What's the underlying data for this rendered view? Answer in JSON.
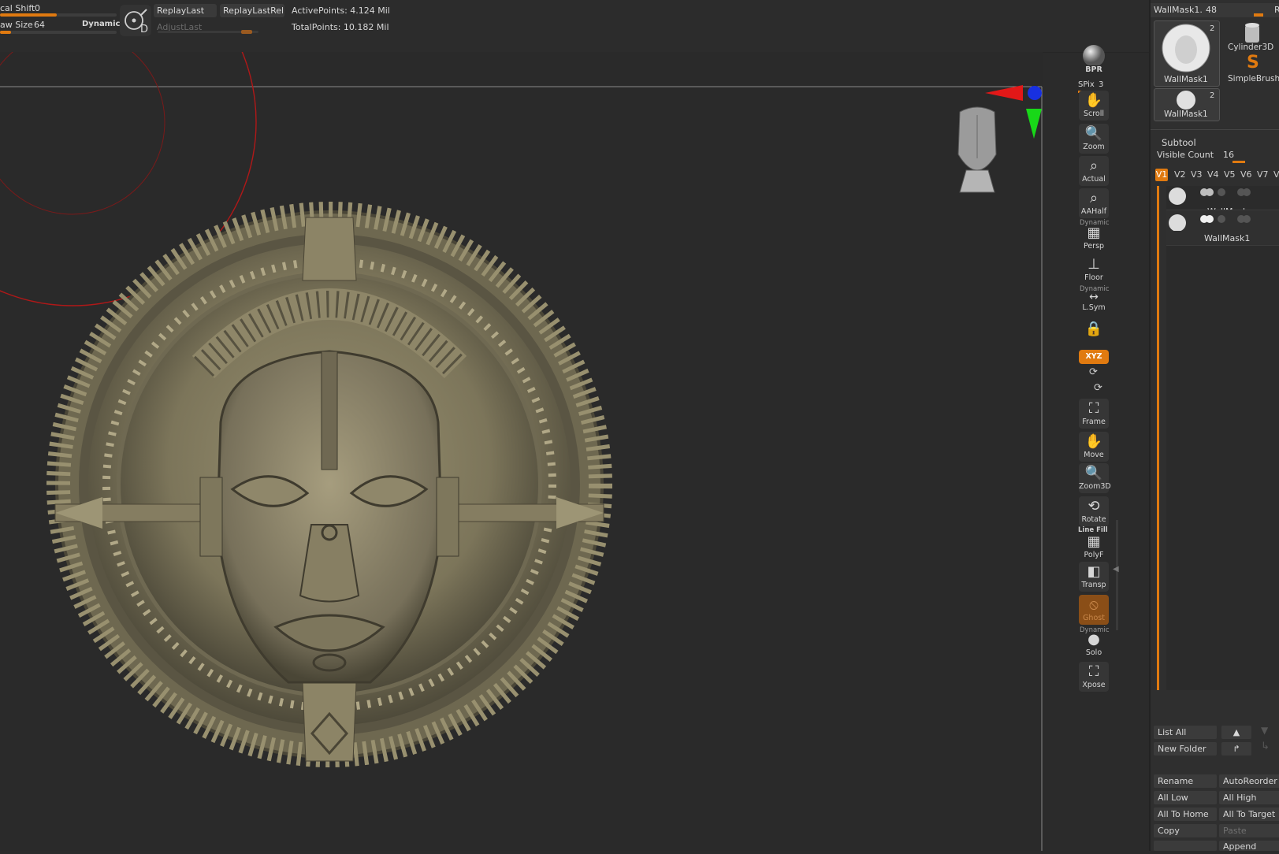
{
  "toolbar": {
    "focal_shift_label": "cal Shift",
    "focal_shift_value": "0",
    "focal_shift_level": 0.15,
    "draw_size_label": "aw Size",
    "draw_size_value": "64",
    "draw_size_level": 0.1,
    "dynamic_label": "Dynamic",
    "replay_last_label": "ReplayLast",
    "replay_last_rel_label": "ReplayLastRel",
    "adjust_last_label": "AdjustLast",
    "active_points": "ActivePoints: 4.124 Mil",
    "total_points": "TotalPoints: 10.182 Mil",
    "d_label": "D"
  },
  "shelf": {
    "bpr_label": "BPR",
    "spix_label": "SPix",
    "spix_value": "3",
    "buttons": [
      {
        "label": "Scroll",
        "icon": "hand-icon"
      },
      {
        "label": "Zoom",
        "icon": "zoom-icon"
      },
      {
        "label": "Actual",
        "icon": "actual-icon"
      },
      {
        "label": "AAHalf",
        "icon": "aahalf-icon"
      },
      {
        "label": "Persp",
        "icon": "persp-icon"
      },
      {
        "label": "Floor",
        "icon": "floor-icon"
      },
      {
        "label": "L.Sym",
        "icon": "lsym-icon"
      }
    ],
    "dynamic_top": "Dynamic",
    "dynamic_lsym": "Dynamic",
    "xyz_label": "XYZ",
    "frame_label": "Frame",
    "move_label": "Move",
    "zoom3d_label": "Zoom3D",
    "rotate_label": "Rotate",
    "line_fill_label": "Line Fill",
    "polyf_label": "PolyF",
    "transp_label": "Transp",
    "ghost_label": "Ghost",
    "dynamic_solo": "Dynamic",
    "solo_label": "Solo",
    "xpose_label": "Xpose"
  },
  "panel": {
    "tool_name": "WallMask1.",
    "tool_count": "48",
    "r_label": "R",
    "thumb1_label": "WallMask1",
    "thumb1_badge": "2",
    "cylinder_label": "Cylinder3D",
    "simplebrush_label": "SimpleBrush",
    "thumb2_label": "WallMask1",
    "thumb2_badge": "2",
    "subtool_title": "Subtool",
    "visible_count_label": "Visible Count",
    "visible_count_value": "16",
    "visible_count_level": 0.8,
    "vtabs": [
      "V1",
      "V2",
      "V3",
      "V4",
      "V5",
      "V6",
      "V7",
      "V"
    ],
    "subtools": [
      {
        "name": "WallMask"
      },
      {
        "name": "WallMask1"
      }
    ],
    "list_all": "List All",
    "new_folder": "New Folder",
    "rename": "Rename",
    "auto_reorder": "AutoReorder",
    "all_low": "All Low",
    "all_high": "All High",
    "all_to_home": "All To Home",
    "all_to_target": "All To Target",
    "copy": "Copy",
    "paste": "Paste",
    "append": "Append"
  },
  "colors": {
    "accent": "#e07a10",
    "background": "#2a2a2a",
    "brush_ring": "#b01818",
    "gizmo_red": "#e21818",
    "gizmo_green": "#18d818",
    "gizmo_blue": "#1830e0"
  }
}
